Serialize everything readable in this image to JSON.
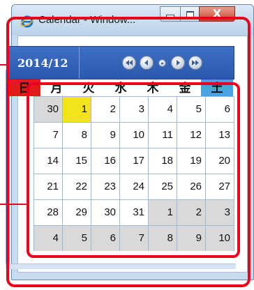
{
  "window": {
    "title": "Calendar - Window...",
    "icon": "internet-explorer-icon",
    "minimize": "minimize-icon",
    "maximize": "maximize-icon",
    "close_glyph": "X"
  },
  "calendar": {
    "month_label": "2014/12",
    "nav": [
      "first-icon",
      "prev-icon",
      "home-dot-icon",
      "next-icon",
      "last-icon"
    ],
    "weekdays": [
      "日",
      "月",
      "火",
      "水",
      "木",
      "金",
      "土"
    ],
    "weeks": [
      [
        "30",
        "1",
        "2",
        "3",
        "4",
        "5",
        "6"
      ],
      [
        "7",
        "8",
        "9",
        "10",
        "11",
        "12",
        "13"
      ],
      [
        "14",
        "15",
        "16",
        "17",
        "18",
        "19",
        "20"
      ],
      [
        "21",
        "22",
        "23",
        "24",
        "25",
        "26",
        "27"
      ],
      [
        "28",
        "29",
        "30",
        "31",
        "1",
        "2",
        "3"
      ],
      [
        "4",
        "5",
        "6",
        "7",
        "8",
        "9",
        "10"
      ]
    ],
    "other_month_cells": [
      [
        0,
        0
      ],
      [
        4,
        4
      ],
      [
        4,
        5
      ],
      [
        4,
        6
      ],
      [
        5,
        0
      ],
      [
        5,
        1
      ],
      [
        5,
        2
      ],
      [
        5,
        3
      ],
      [
        5,
        4
      ],
      [
        5,
        5
      ],
      [
        5,
        6
      ]
    ],
    "today_cell": [
      0,
      1
    ],
    "colors": {
      "header": "#2a59ad",
      "sunday": "#e21a1a",
      "saturday": "#4aa3e0",
      "today": "#f3e31b",
      "other_month": "#d9d9d9",
      "highlight": "#e8001c"
    }
  }
}
